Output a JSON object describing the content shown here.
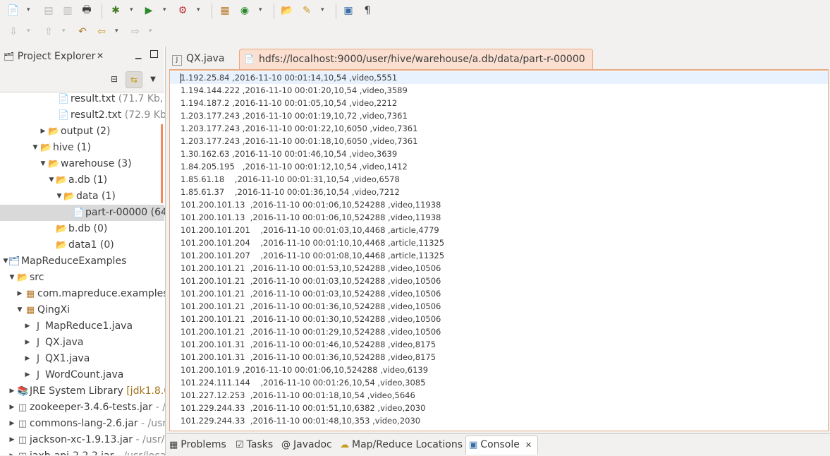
{
  "toolbar": {
    "row1": [
      "new-icon",
      "save-icon",
      "save-all-icon",
      "print-icon",
      "debug-icon",
      "run-icon",
      "external-tools-icon",
      "new-package-icon",
      "new-class-icon",
      "open-type-icon",
      "search-icon",
      "toggle-mark-icon",
      "show-whitespace-icon"
    ],
    "row2": [
      "next-annotation-icon",
      "previous-annotation-icon",
      "last-edit-icon",
      "back-icon",
      "forward-icon"
    ]
  },
  "explorer": {
    "title": "Project Explorer",
    "tree": [
      {
        "name": "result.txt",
        "meta": "(71.7 Kb, r",
        "type": "file"
      },
      {
        "name": "result2.txt",
        "meta": "(72.9 Kb, r",
        "type": "file"
      },
      {
        "name": "output (2)",
        "meta": "",
        "type": "folder"
      },
      {
        "name": "hive (1)",
        "meta": "",
        "type": "folder"
      },
      {
        "name": "warehouse (3)",
        "meta": "",
        "type": "folder"
      },
      {
        "name": "a.db (1)",
        "meta": "",
        "type": "folder"
      },
      {
        "name": "data (1)",
        "meta": "",
        "type": "folder"
      },
      {
        "name": "part-r-00000 (64.",
        "meta": "",
        "type": "file"
      },
      {
        "name": "b.db (0)",
        "meta": "",
        "type": "folder"
      },
      {
        "name": "data1 (0)",
        "meta": "",
        "type": "folder"
      },
      {
        "name": "MapReduceExamples",
        "meta": "",
        "type": "project"
      },
      {
        "name": "src",
        "meta": "",
        "type": "srcfolder"
      },
      {
        "name": "com.mapreduce.examples",
        "meta": "",
        "type": "package"
      },
      {
        "name": "QingXi",
        "meta": "",
        "type": "package"
      },
      {
        "name": "MapReduce1.java",
        "meta": "",
        "type": "java"
      },
      {
        "name": "QX.java",
        "meta": "",
        "type": "java"
      },
      {
        "name": "QX1.java",
        "meta": "",
        "type": "java"
      },
      {
        "name": "WordCount.java",
        "meta": "",
        "type": "java"
      },
      {
        "name": "JRE System Library",
        "meta": "[jdk1.8.0",
        "type": "library"
      },
      {
        "name": "zookeeper-3.4.6-tests.jar",
        "meta": "- /u",
        "type": "jar"
      },
      {
        "name": "commons-lang-2.6.jar",
        "meta": "- /usr/",
        "type": "jar"
      },
      {
        "name": "jackson-xc-1.9.13.jar",
        "meta": "- /usr/lo",
        "type": "jar"
      },
      {
        "name": "jaxb-api-2.2.2.jar",
        "meta": "- /usr/local",
        "type": "jar"
      }
    ]
  },
  "editor": {
    "tabs": [
      {
        "label": "QX.java"
      },
      {
        "label": "hdfs://localhost:9000/user/hive/warehouse/a.db/data/part-r-00000"
      }
    ],
    "lines": [
      "1.192.25.84 ,2016-11-10 00:01:14,10,54 ,video,5551",
      "1.194.144.222 ,2016-11-10 00:01:20,10,54 ,video,3589",
      "1.194.187.2 ,2016-11-10 00:01:05,10,54 ,video,2212",
      "1.203.177.243 ,2016-11-10 00:01:19,10,72 ,video,7361",
      "1.203.177.243 ,2016-11-10 00:01:22,10,6050 ,video,7361",
      "1.203.177.243 ,2016-11-10 00:01:18,10,6050 ,video,7361",
      "1.30.162.63 ,2016-11-10 00:01:46,10,54 ,video,3639",
      "1.84.205.195   ,2016-11-10 00:01:12,10,54 ,video,1412",
      "1.85.61.18    ,2016-11-10 00:01:31,10,54 ,video,6578",
      "1.85.61.37    ,2016-11-10 00:01:36,10,54 ,video,7212",
      "101.200.101.13  ,2016-11-10 00:01:06,10,524288 ,video,11938",
      "101.200.101.13  ,2016-11-10 00:01:06,10,524288 ,video,11938",
      "101.200.101.201    ,2016-11-10 00:01:03,10,4468 ,article,4779",
      "101.200.101.204    ,2016-11-10 00:01:10,10,4468 ,article,11325",
      "101.200.101.207    ,2016-11-10 00:01:08,10,4468 ,article,11325",
      "101.200.101.21  ,2016-11-10 00:01:53,10,524288 ,video,10506",
      "101.200.101.21  ,2016-11-10 00:01:03,10,524288 ,video,10506",
      "101.200.101.21  ,2016-11-10 00:01:03,10,524288 ,video,10506",
      "101.200.101.21  ,2016-11-10 00:01:36,10,524288 ,video,10506",
      "101.200.101.21  ,2016-11-10 00:01:30,10,524288 ,video,10506",
      "101.200.101.21  ,2016-11-10 00:01:29,10,524288 ,video,10506",
      "101.200.101.31  ,2016-11-10 00:01:46,10,524288 ,video,8175",
      "101.200.101.31  ,2016-11-10 00:01:36,10,524288 ,video,8175",
      "101.200.101.9 ,2016-11-10 00:01:06,10,524288 ,video,6139",
      "101.224.111.144    ,2016-11-10 00:01:26,10,54 ,video,3085",
      "101.227.12.253  ,2016-11-10 00:01:18,10,54 ,video,5646",
      "101.229.244.33  ,2016-11-10 00:01:51,10,6382 ,video,2030",
      "101.229.244.33  ,2016-11-10 00:01:48,10,353 ,video,2030"
    ]
  },
  "bottom_tabs": [
    {
      "label": "Problems",
      "icon": "problems-icon"
    },
    {
      "label": "Tasks",
      "icon": "tasks-icon"
    },
    {
      "label": "Javadoc",
      "icon": "javadoc-icon"
    },
    {
      "label": "Map/Reduce Locations",
      "icon": "map-reduce-icon"
    },
    {
      "label": "Console",
      "icon": "console-icon"
    }
  ],
  "colors": {
    "accent_tab": "#fbe0d1",
    "accent_border": "#e9a882",
    "selection": "#d9d9d9"
  }
}
